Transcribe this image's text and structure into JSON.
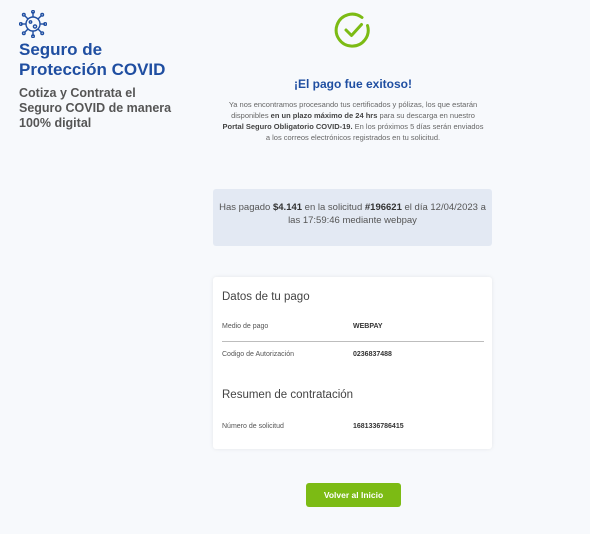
{
  "brand": {
    "title_line1": "Seguro de",
    "title_line2": "Protección COVID",
    "subtitle_line1": "Cotiza y Contrata el",
    "subtitle_line2": "Seguro COVID de manera",
    "subtitle_line3": "100% digital",
    "icon": "virus-icon"
  },
  "colors": {
    "brand_blue": "#1f4ea1",
    "success_green": "#7cbb14",
    "info_box_bg": "#e3e9f3"
  },
  "success": {
    "icon": "check-circle-icon",
    "title": "¡El pago fue exitoso!",
    "text_part1": "Ya nos encontramos procesando tus certificados y pólizas, los que estarán disponibles ",
    "text_bold1": "en un plazo máximo de 24 hrs",
    "text_part2": " para su descarga en nuestro ",
    "text_bold2": "Portal Seguro Obligatorio COVID-19.",
    "text_part3": " En los próximos 5 días serán enviados a los correos electrónicos registrados en tu solicitud."
  },
  "payment_summary": {
    "prefix": "Has pagado ",
    "amount": "$4.141",
    "middle": " en la solicitud ",
    "request_id": "#196621",
    "suffix": " el día 12/04/2023 a las 17:59:46 mediante webpay"
  },
  "payment_details": {
    "section_title": "Datos de tu pago",
    "rows": [
      {
        "label": "Medio de pago",
        "value": "WEBPAY"
      },
      {
        "label": "Codigo de Autorización",
        "value": "0236837488"
      }
    ]
  },
  "contract_summary": {
    "section_title": "Resumen de contratación",
    "rows": [
      {
        "label": "Número de solicitud",
        "value": "1681336786415"
      }
    ]
  },
  "actions": {
    "back_label": "Volver al Inicio"
  }
}
